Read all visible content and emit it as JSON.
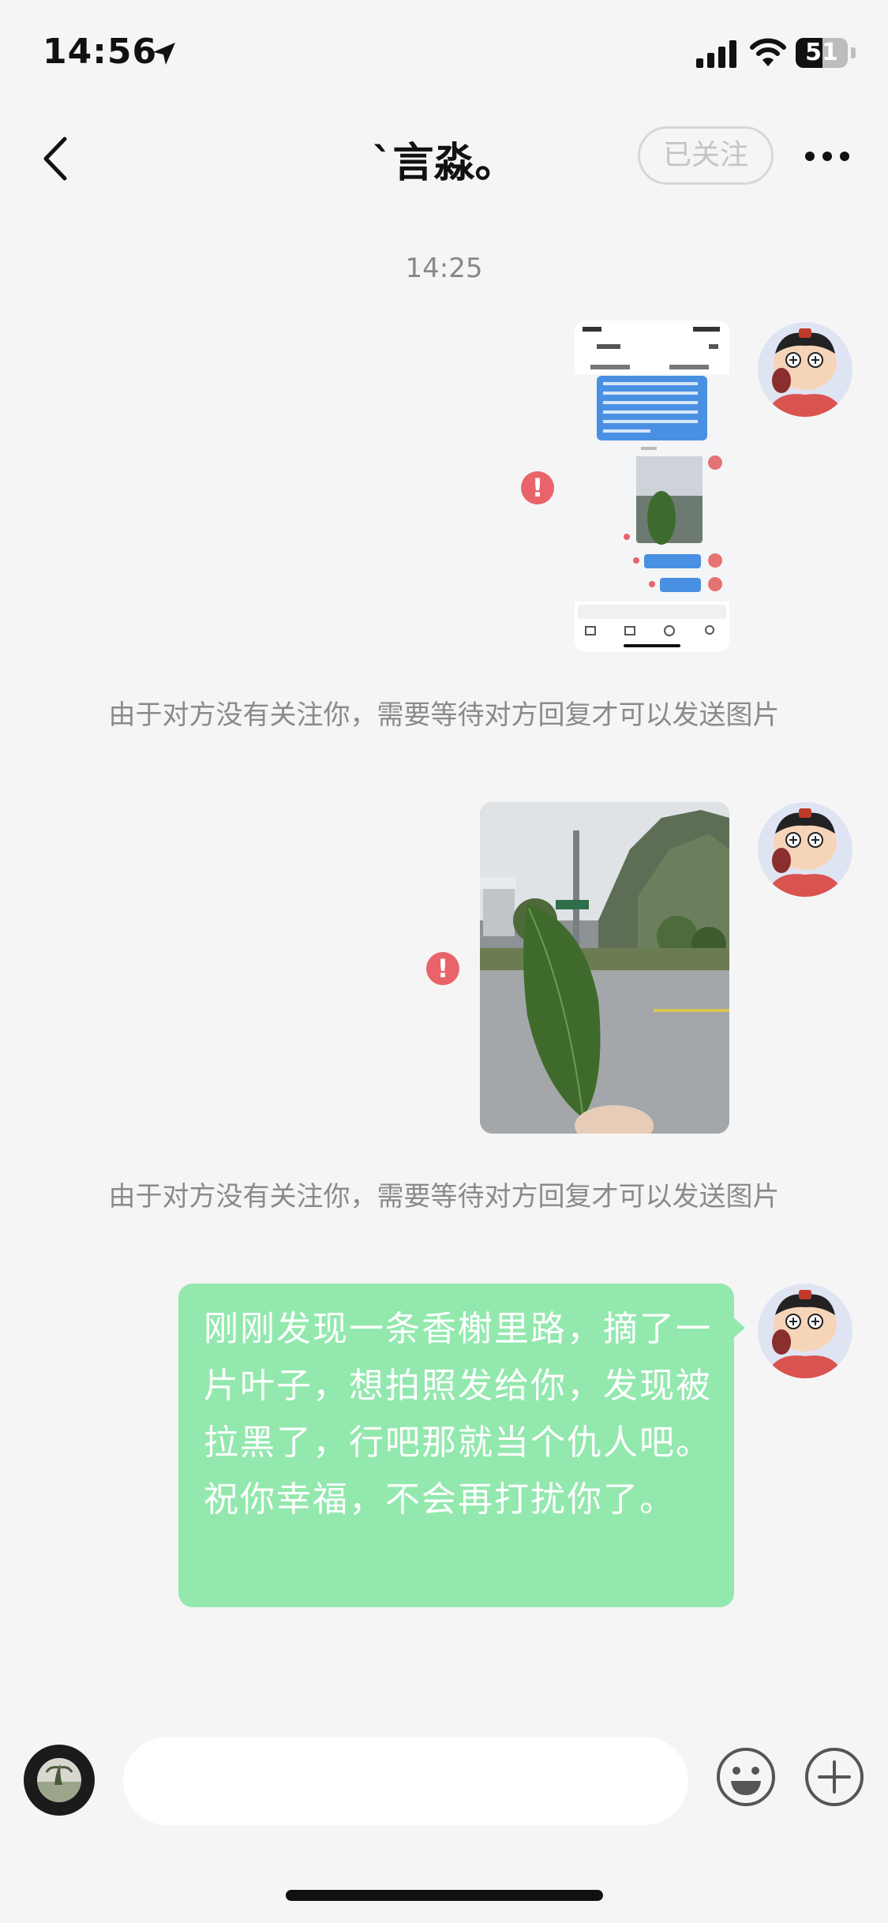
{
  "status_bar": {
    "time": "14:56",
    "battery": "51",
    "battery_level": 0.51
  },
  "nav": {
    "title": "ˋ言淼。",
    "follow_label": "已关注"
  },
  "chat": {
    "timestamp": "14:25",
    "notice_1": "由于对方没有关注你，需要等待对方回复才可以发送图片",
    "notice_2": "由于对方没有关注你，需要等待对方回复才可以发送图片",
    "error_mark": "!",
    "text_message": "刚刚发现一条香榭里路，摘了一片叶子，想拍照发给你，发现被拉黑了，行吧那就当个仇人吧。祝你幸福，不会再打扰你了。"
  },
  "input": {
    "placeholder": ""
  },
  "colors": {
    "bubble": "#93e8ae",
    "error": "#e9646a",
    "background": "#f5f5f6"
  },
  "icons": [
    "location-arrow-icon",
    "signal-icon",
    "wifi-icon",
    "battery-icon",
    "back-icon",
    "more-icon",
    "error-icon",
    "emoji-icon",
    "plus-icon"
  ]
}
